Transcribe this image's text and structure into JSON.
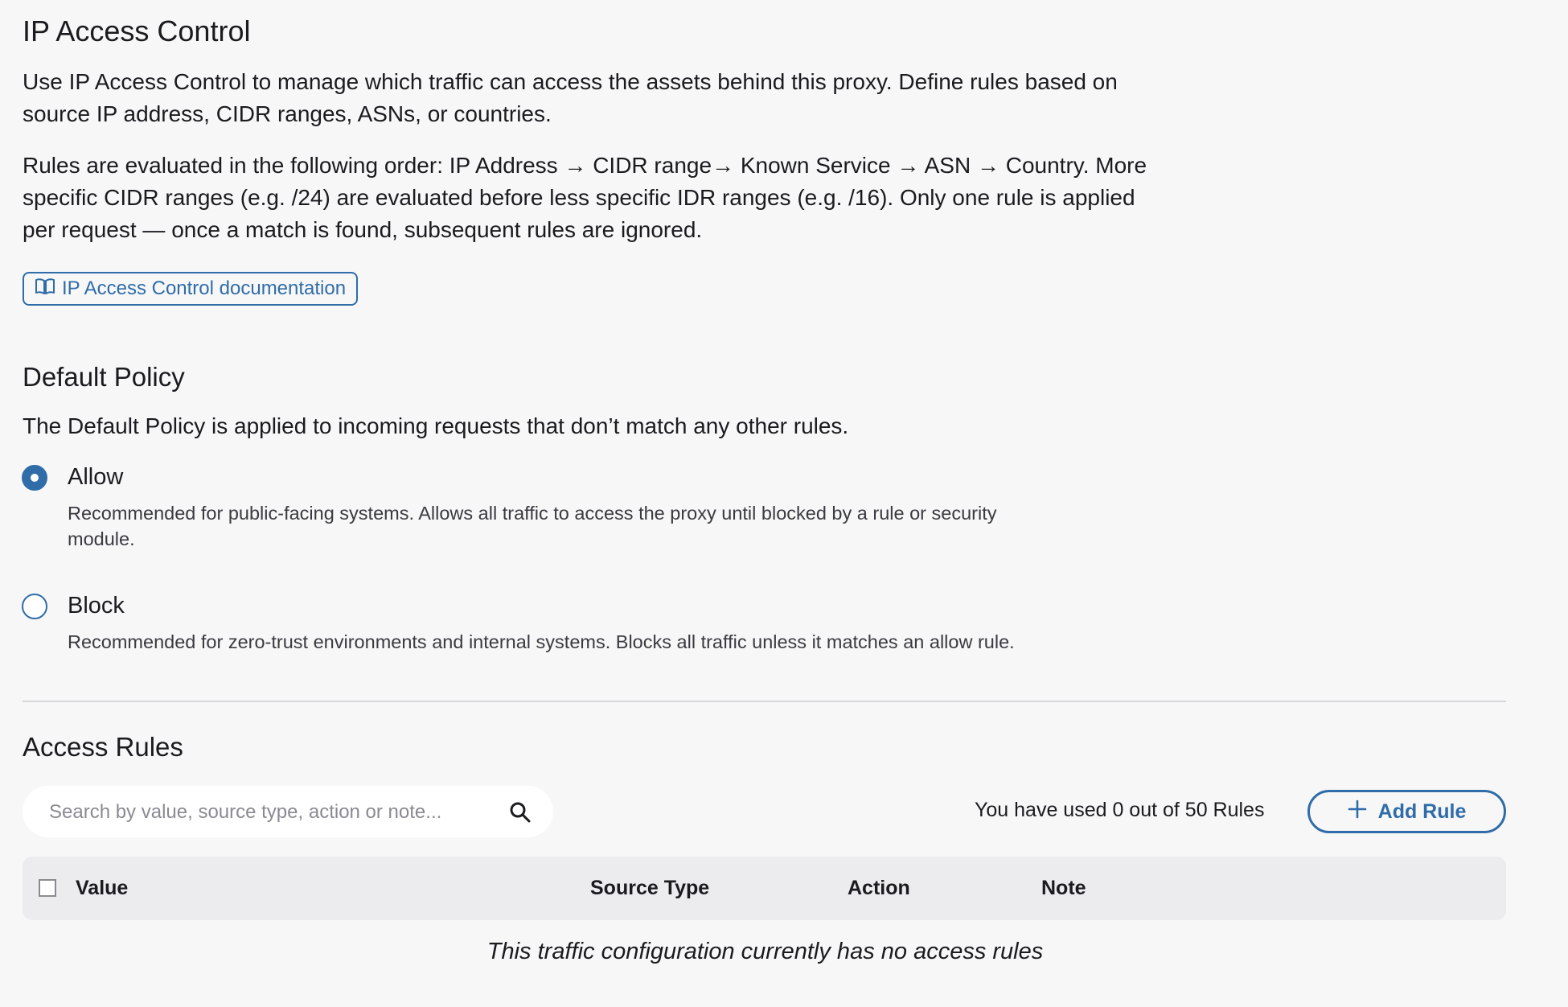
{
  "header": {
    "title": "IP Access Control",
    "intro": "Use IP Access Control to manage which traffic can access the assets behind this proxy. Define rules based on source IP address, CIDR ranges, ASNs, or countries.",
    "order_text": "Rules are evaluated in the following order: IP Address → CIDR range→ Known Service → ASN → Country. More specific CIDR ranges (e.g. /24) are evaluated before less specific IDR ranges (e.g. /16). Only one rule is applied per request — once a match is found, subsequent rules are ignored.",
    "doc_link_label": "IP Access Control documentation",
    "doc_icon": "book-icon"
  },
  "default_policy": {
    "title": "Default Policy",
    "description": "The Default Policy is applied to incoming requests that don’t match any other rules.",
    "selected": "allow",
    "options": [
      {
        "id": "allow",
        "label": "Allow",
        "description": "Recommended for public-facing systems. Allows all traffic to access the proxy until blocked by a rule or security module."
      },
      {
        "id": "block",
        "label": "Block",
        "description": "Recommended for zero-trust environments and internal systems. Blocks all traffic unless it matches an allow rule."
      }
    ]
  },
  "access_rules": {
    "title": "Access Rules",
    "search_placeholder": "Search by value, source type, action or note...",
    "search_icon": "search-icon",
    "usage_text": "You have used 0 out of 50 Rules",
    "rules_used": 0,
    "rules_max": 50,
    "add_button_label": "Add Rule",
    "add_icon": "plus-icon",
    "columns": [
      "Value",
      "Source Type",
      "Action",
      "Note"
    ],
    "empty_message": "This traffic configuration currently has no access rules"
  },
  "colors": {
    "accent": "#2f6ca8",
    "background": "#f7f7f8",
    "table_header": "#ececee"
  }
}
